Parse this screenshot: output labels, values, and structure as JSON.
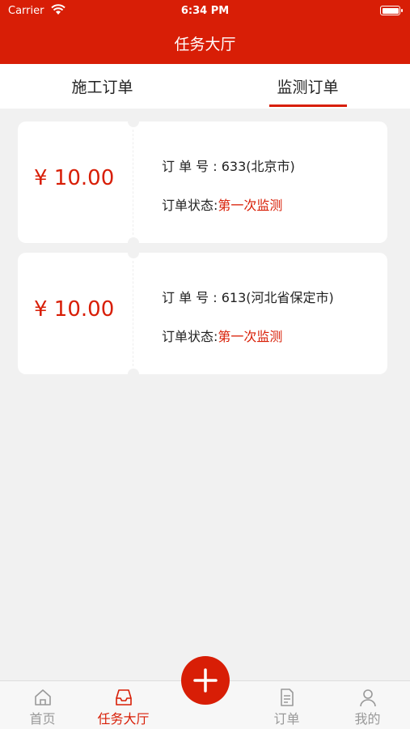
{
  "status_bar": {
    "carrier": "Carrier",
    "time": "6:34 PM"
  },
  "header": {
    "title": "任务大厅"
  },
  "tabs": [
    {
      "label": "施工订单",
      "active": false
    },
    {
      "label": "监测订单",
      "active": true
    }
  ],
  "orders": [
    {
      "price": "¥ 10.00",
      "order_no_label": "订 单 号 : ",
      "order_no": "633(北京市)",
      "status_label": "订单状态:",
      "status": "第一次监测"
    },
    {
      "price": "¥ 10.00",
      "order_no_label": "订 单 号 : ",
      "order_no": "613(河北省保定市)",
      "status_label": "订单状态:",
      "status": "第一次监测"
    }
  ],
  "tabbar": {
    "items": [
      {
        "label": "首页",
        "icon": "home-icon",
        "active": false
      },
      {
        "label": "任务大厅",
        "icon": "inbox-icon",
        "active": true
      },
      {
        "label": "订单",
        "icon": "document-icon",
        "active": false
      },
      {
        "label": "我的",
        "icon": "user-icon",
        "active": false
      }
    ],
    "fab_icon": "plus-icon"
  },
  "colors": {
    "accent": "#d81e06",
    "background": "#f1f1f1",
    "inactive": "#999999"
  }
}
